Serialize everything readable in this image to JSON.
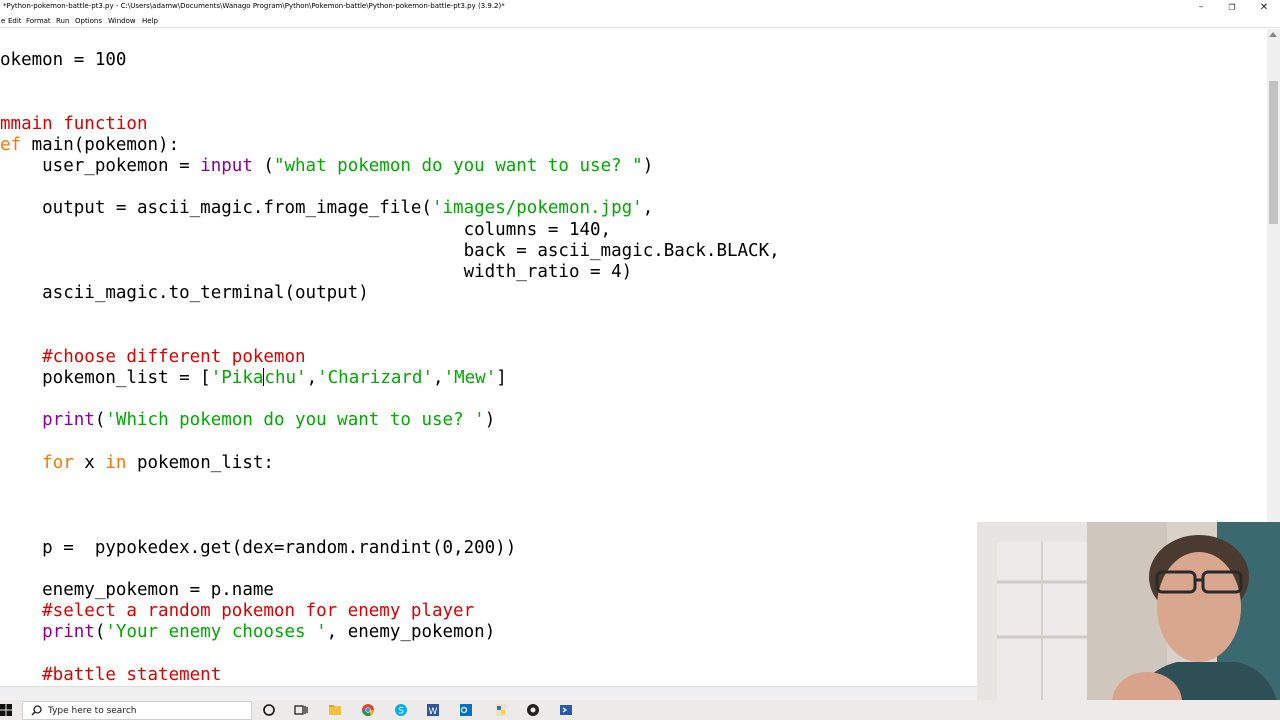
{
  "window": {
    "title": "*Python-pokemon-battle-pt3.py - C:\\Users\\adamw\\Documents\\Wanago Program\\Python\\Pokemon-battle\\Python-pokemon-battle-pt3.py (3.9.2)*",
    "minimize_glyph": "–",
    "maximize_glyph": "❐",
    "close_glyph": "✕"
  },
  "menu": [
    "e",
    "Edit",
    "Format",
    "Run",
    "Options",
    "Window",
    "Help"
  ],
  "code_lines": [
    {
      "segs": [
        {
          "t": "okemon = 100",
          "c": "t"
        }
      ]
    },
    {
      "segs": []
    },
    {
      "segs": []
    },
    {
      "segs": [
        {
          "t": "mmain function",
          "c": "c"
        }
      ]
    },
    {
      "segs": [
        {
          "t": "ef",
          "c": "k"
        },
        {
          "t": " main(pokemon):",
          "c": "t"
        }
      ]
    },
    {
      "segs": [
        {
          "t": "    user_pokemon = ",
          "c": "t"
        },
        {
          "t": "input",
          "c": "b"
        },
        {
          "t": " (",
          "c": "t"
        },
        {
          "t": "\"what pokemon do you want to use? \"",
          "c": "s"
        },
        {
          "t": ")",
          "c": "t"
        }
      ]
    },
    {
      "segs": []
    },
    {
      "segs": [
        {
          "t": "    output = ascii_magic.from_image_file(",
          "c": "t"
        },
        {
          "t": "'images/pokemon.jpg'",
          "c": "s"
        },
        {
          "t": ",",
          "c": "t"
        }
      ]
    },
    {
      "segs": [
        {
          "t": "                                            columns = 140,",
          "c": "t"
        }
      ]
    },
    {
      "segs": [
        {
          "t": "                                            back = ascii_magic.Back.BLACK,",
          "c": "t"
        }
      ]
    },
    {
      "segs": [
        {
          "t": "                                            width_ratio = 4)",
          "c": "t"
        }
      ]
    },
    {
      "segs": [
        {
          "t": "    ascii_magic.to_terminal(output)",
          "c": "t"
        }
      ]
    },
    {
      "segs": []
    },
    {
      "segs": []
    },
    {
      "segs": [
        {
          "t": "    #choose different pokemon",
          "c": "c"
        }
      ]
    },
    {
      "segs": [
        {
          "t": "    pokemon_list = [",
          "c": "t"
        },
        {
          "t": "'Pika",
          "c": "s"
        },
        {
          "t": "",
          "c": "caret"
        },
        {
          "t": "chu'",
          "c": "s"
        },
        {
          "t": ",",
          "c": "t"
        },
        {
          "t": "'Charizard'",
          "c": "s"
        },
        {
          "t": ",",
          "c": "t"
        },
        {
          "t": "'Mew'",
          "c": "s"
        },
        {
          "t": "]",
          "c": "t"
        }
      ]
    },
    {
      "segs": []
    },
    {
      "segs": [
        {
          "t": "    ",
          "c": "t"
        },
        {
          "t": "print",
          "c": "b"
        },
        {
          "t": "(",
          "c": "t"
        },
        {
          "t": "'Which pokemon do you want to use? '",
          "c": "s"
        },
        {
          "t": ")",
          "c": "t"
        }
      ]
    },
    {
      "segs": []
    },
    {
      "segs": [
        {
          "t": "    ",
          "c": "t"
        },
        {
          "t": "for",
          "c": "k"
        },
        {
          "t": " x ",
          "c": "t"
        },
        {
          "t": "in",
          "c": "k"
        },
        {
          "t": " pokemon_list:",
          "c": "t"
        }
      ]
    },
    {
      "segs": []
    },
    {
      "segs": []
    },
    {
      "segs": []
    },
    {
      "segs": [
        {
          "t": "    p =  pypokedex.get(dex=random.randint(0,200))",
          "c": "t"
        }
      ]
    },
    {
      "segs": []
    },
    {
      "segs": [
        {
          "t": "    enemy_pokemon = p.name",
          "c": "t"
        }
      ]
    },
    {
      "segs": [
        {
          "t": "    #select a random pokemon for enemy player",
          "c": "c"
        }
      ]
    },
    {
      "segs": [
        {
          "t": "    ",
          "c": "t"
        },
        {
          "t": "print",
          "c": "b"
        },
        {
          "t": "(",
          "c": "t"
        },
        {
          "t": "'Your enemy chooses '",
          "c": "s"
        },
        {
          "t": ", enemy_pokemon)",
          "c": "t"
        }
      ]
    },
    {
      "segs": []
    },
    {
      "segs": [
        {
          "t": "    #battle statement",
          "c": "c"
        }
      ]
    }
  ],
  "taskbar": {
    "search_placeholder": "Type here to search",
    "icons": [
      "windows-start-icon",
      "search-icon",
      "task-view-icon",
      "multitasking-icon",
      "file-explorer-icon",
      "chrome-icon",
      "skype-icon",
      "word-icon",
      "outlook-icon",
      "python-idle-icon",
      "github-icon",
      "powershell-icon"
    ]
  },
  "colors": {
    "keyword": "#ff7700",
    "builtin": "#900090",
    "string": "#00aa00",
    "comment": "#dd0000",
    "text": "#000000"
  }
}
